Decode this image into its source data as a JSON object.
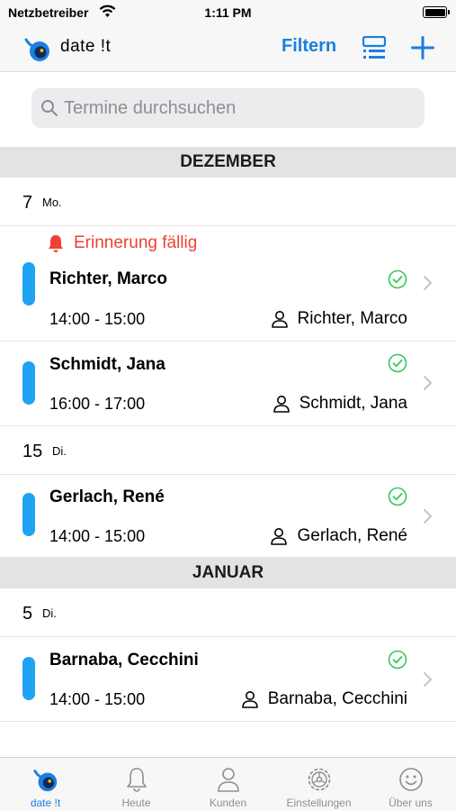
{
  "status_bar": {
    "carrier": "Netzbetreiber",
    "time": "1:11 PM"
  },
  "navbar": {
    "app_title": "date !t",
    "filter_label": "Filtern",
    "accent_color": "#1a7fe0"
  },
  "search": {
    "placeholder": "Termine durchsuchen"
  },
  "sections": [
    {
      "month": "DEZEMBER"
    },
    {
      "month": "JANUAR"
    }
  ],
  "days": [
    {
      "num": "7",
      "name": "Mo."
    },
    {
      "num": "15",
      "name": "Di."
    },
    {
      "num": "5",
      "name": "Di."
    }
  ],
  "reminder": {
    "text": "Erinnerung fällig",
    "color": "#ef4033"
  },
  "appointments": [
    {
      "name": "Richter, Marco",
      "time": "14:00 - 15:00",
      "customer": "Richter, Marco",
      "status_icon": "check-circle-icon"
    },
    {
      "name": "Schmidt, Jana",
      "time": "16:00 - 17:00",
      "customer": "Schmidt, Jana",
      "status_icon": "check-circle-icon"
    },
    {
      "name": "Gerlach, René",
      "time": "14:00 - 15:00",
      "customer": "Gerlach, René",
      "status_icon": "check-circle-icon"
    },
    {
      "name": "Barnaba, Cecchini",
      "time": "14:00 - 15:00",
      "customer": "Barnaba, Cecchini",
      "status_icon": "check-circle-icon"
    }
  ],
  "tabbar": {
    "items": [
      {
        "label": "date !t",
        "icon": "app-logo-icon",
        "active": true
      },
      {
        "label": "Heute",
        "icon": "bell-icon"
      },
      {
        "label": "Kunden",
        "icon": "person-icon"
      },
      {
        "label": "Einstellungen",
        "icon": "gear-icon"
      },
      {
        "label": "Über uns",
        "icon": "smiley-icon"
      }
    ]
  }
}
